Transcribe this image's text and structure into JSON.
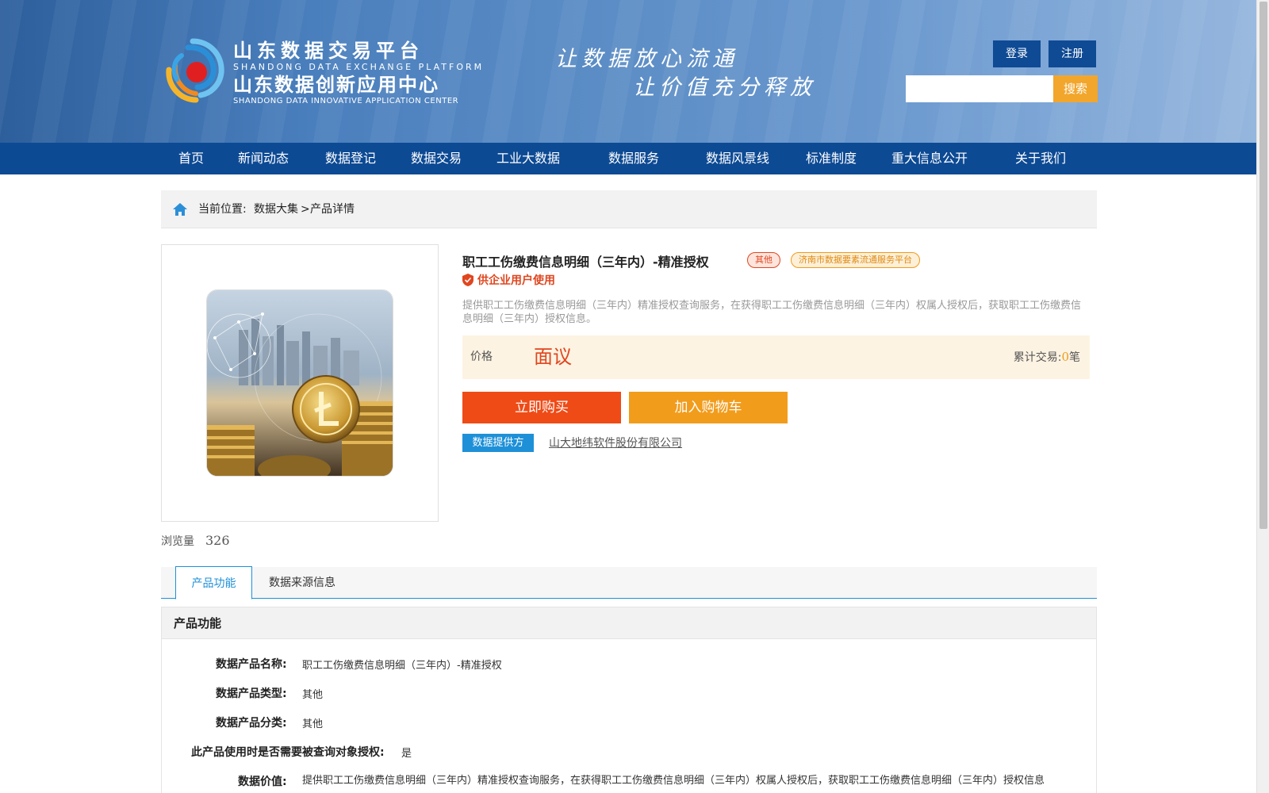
{
  "header": {
    "brand_cn1": "山东数据交易平台",
    "brand_en1": "SHANDONG DATA EXCHANGE PLATFORM",
    "brand_cn2": "山东数据创新应用中心",
    "brand_en2": "SHANDONG DATA INNOVATIVE APPLICATION CENTER",
    "slogan_line1": "让数据放心流通",
    "slogan_line2": "让价值充分释放",
    "login_label": "登录",
    "register_label": "注册",
    "search_placeholder": "",
    "search_button_label": "搜索"
  },
  "nav": {
    "items": [
      "首页",
      "新闻动态",
      "数据登记",
      "数据交易",
      "工业大数据",
      "数据服务",
      "数据风景线",
      "标准制度",
      "重大信息公开",
      "关于我们"
    ]
  },
  "breadcrumb": {
    "label": "当前位置:",
    "level1": "数据大集",
    "separator": ">",
    "level2": "产品详情"
  },
  "product": {
    "title": "职工工伤缴费信息明细（三年内）-精准授权",
    "tag_category": "其他",
    "tag_platform": "济南市数据要素流通服务平台",
    "audience": "供企业用户使用",
    "description": "提供职工工伤缴费信息明细（三年内）精准授权查询服务，在获得职工工伤缴费信息明细（三年内）权属人授权后，获取职工工伤缴费信息明细（三年内）授权信息。",
    "price_label": "价格",
    "price_value": "面议",
    "trade_label": "累计交易:",
    "trade_count": "0",
    "trade_unit": "笔",
    "buy_now_label": "立即购买",
    "add_cart_label": "加入购物车",
    "provider_label": "数据提供方",
    "provider_name": "山大地纬软件股份有限公司",
    "views_label": "浏览量",
    "views_count": "326"
  },
  "tabs": {
    "items": [
      "产品功能",
      "数据来源信息"
    ],
    "active": "产品功能"
  },
  "function_panel": {
    "header": "产品功能",
    "rows": [
      {
        "label": "数据产品名称:",
        "value": "职工工伤缴费信息明细（三年内）-精准授权"
      },
      {
        "label": "数据产品类型:",
        "value": "其他"
      },
      {
        "label": "数据产品分类:",
        "value": "其他"
      },
      {
        "label": "此产品使用时是否需要被查询对象授权:",
        "value": "是"
      },
      {
        "label": "数据价值:",
        "value": "提供职工工伤缴费信息明细（三年内）精准授权查询服务，在获得职工工伤缴费信息明细（三年内）权属人授权后，获取职工工伤缴费信息明细（三年内）授权信息"
      }
    ]
  },
  "colors": {
    "nav_bg": "#0d4a94",
    "accent_orange": "#f29c1c",
    "accent_red": "#ef4b17",
    "accent_blue": "#1e90d8"
  }
}
